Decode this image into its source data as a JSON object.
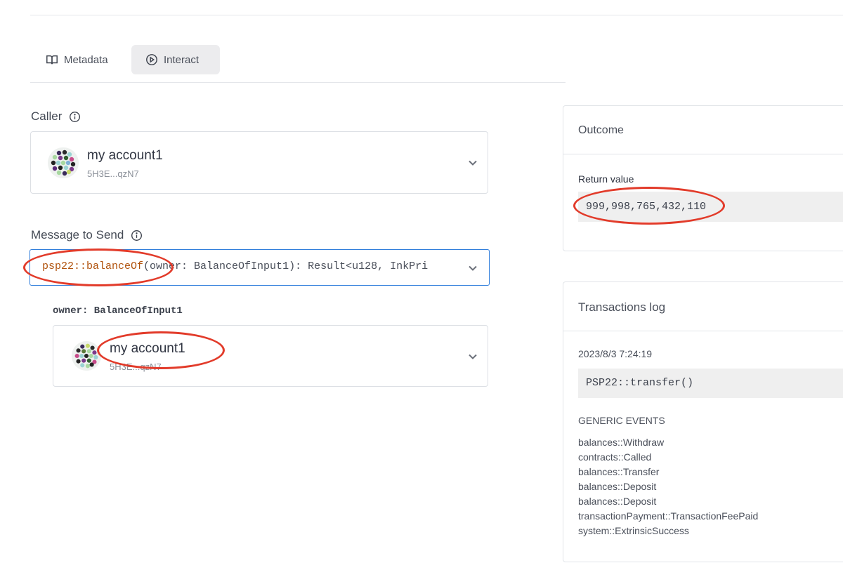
{
  "tabs": [
    {
      "label": "Metadata",
      "icon": "book-icon",
      "active": false
    },
    {
      "label": "Interact",
      "icon": "play-circle-icon",
      "active": true
    }
  ],
  "caller": {
    "label": "Caller",
    "account_name": "my account1",
    "account_address": "5H3E...qzN7"
  },
  "message": {
    "label": "Message to Send",
    "function_name": "psp22::balanceOf",
    "signature_rest": "(owner: BalanceOfInput1): Result<u128, InkPri"
  },
  "param": {
    "label": "owner: BalanceOfInput1",
    "account_name": "my account1",
    "account_address": "5H3E...qzN7"
  },
  "outcome": {
    "title": "Outcome",
    "return_label": "Return value",
    "return_value": "999,998,765,432,110"
  },
  "transactions_log": {
    "title": "Transactions log",
    "timestamp": "2023/8/3 7:24:19",
    "call": "PSP22::transfer()",
    "events_label": "GENERIC EVENTS",
    "events": [
      "balances::Withdraw",
      "contracts::Called",
      "balances::Transfer",
      "balances::Deposit",
      "balances::Deposit",
      "transactionPayment::TransactionFeePaid",
      "system::ExtrinsicSuccess"
    ]
  },
  "colors": {
    "accent_border": "#2f7ddb",
    "function_color": "#b0520c",
    "annotation_red": "#e23b2a"
  }
}
